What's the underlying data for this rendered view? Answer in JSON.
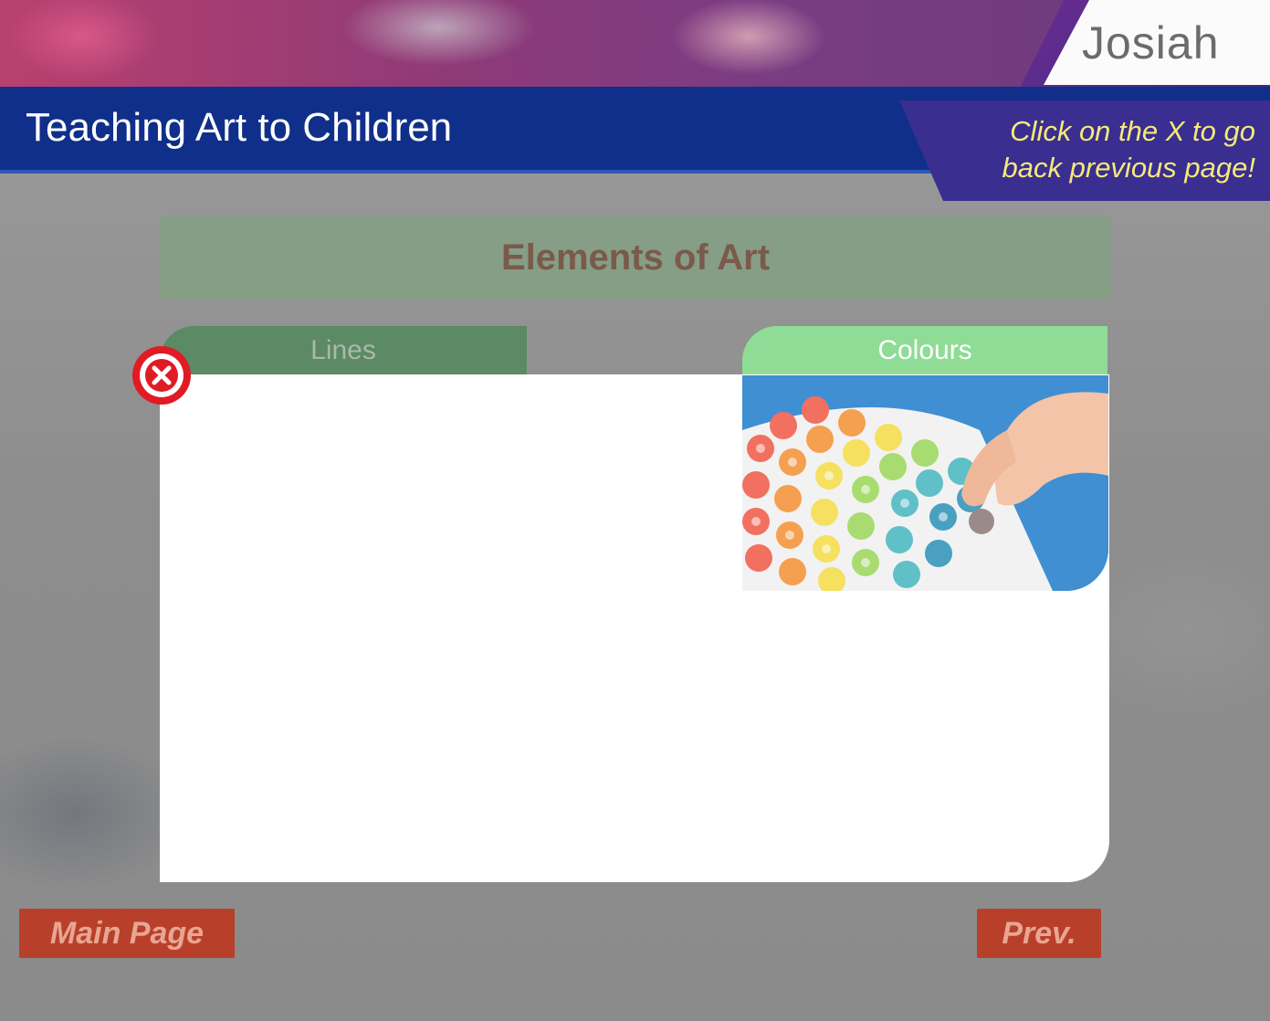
{
  "brand": {
    "logo_text": "Josiah"
  },
  "header": {
    "title": "Teaching Art to Children",
    "hint": "Click on the X to go back previous page!"
  },
  "section": {
    "title": "Elements of Art"
  },
  "tabs": [
    {
      "label": "Lines"
    },
    {
      "label": "Colours"
    }
  ],
  "nav": {
    "main_label": "Main Page",
    "prev_label": "Prev."
  },
  "colors": {
    "header_blue": "#0f2f8a",
    "hint_yellow": "#f5e97a",
    "banner_green": "#869d86",
    "tab_lines": "#5b8a64",
    "tab_colours": "#8edc95",
    "nav_red": "#b8402a",
    "close_red": "#e01b24"
  },
  "icons": {
    "close": "close-x-icon",
    "image": "rainbow-cereal-art-image"
  }
}
